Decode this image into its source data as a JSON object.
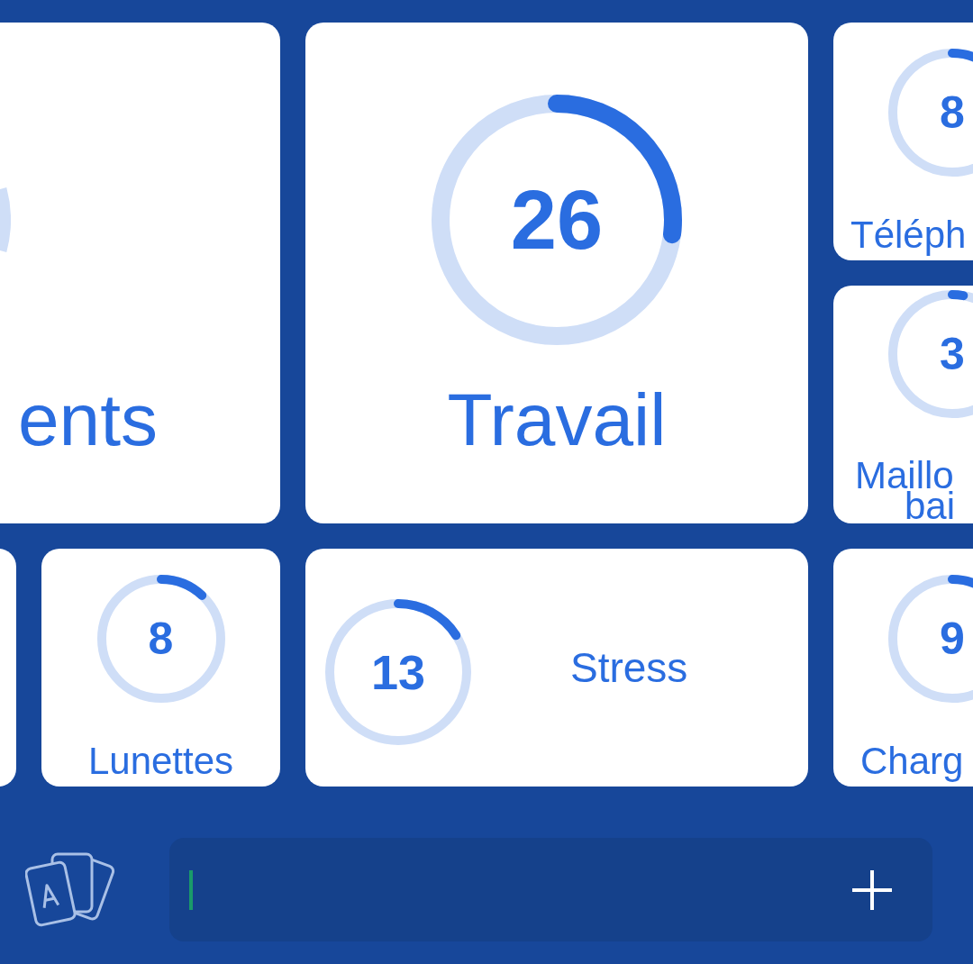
{
  "cards": [
    {
      "kind": "big",
      "label": "ents"
    },
    {
      "kind": "big",
      "number": "26",
      "label": "Travail",
      "level": 0.27
    },
    {
      "kind": "small",
      "number": "8",
      "label_lines": [
        "Téléph"
      ],
      "level": 0.1
    },
    {
      "kind": "small",
      "number": "3",
      "label_lines": [
        "Maillo",
        "bai"
      ],
      "level": 0.03
    },
    {
      "kind": "blank"
    },
    {
      "kind": "small",
      "number": "8",
      "label_lines": [
        "Lunettes"
      ],
      "level": 0.12
    },
    {
      "kind": "wide",
      "number": "13",
      "label": "Stress",
      "level": 0.16
    },
    {
      "kind": "small",
      "number": "9",
      "label_lines": [
        "Charg"
      ],
      "level": 0.1
    }
  ]
}
